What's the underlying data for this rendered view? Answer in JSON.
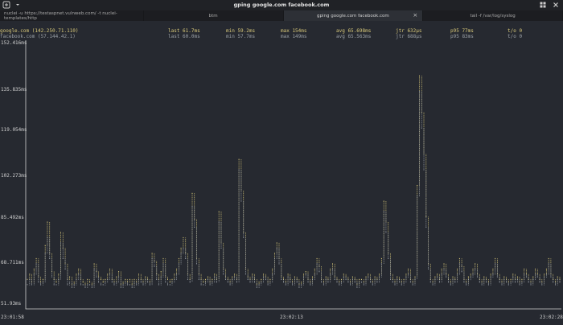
{
  "window": {
    "title": "gping google.com facebook.com",
    "buttons": {
      "new_tab_icon": "plus-icon",
      "menu_icon": "chevron-down-icon",
      "grid_icon": "grid-icon",
      "close_icon": "close-icon"
    }
  },
  "tabs": [
    {
      "label": "nuclei -u https://testaspnet.vulnweb.com/ -t nuclei-templates/http",
      "active": false
    },
    {
      "label": "btm",
      "active": false
    },
    {
      "label": "gping google.com facebook.com",
      "active": true
    },
    {
      "label": "tail -f /var/log/syslog",
      "active": false
    }
  ],
  "hosts": [
    {
      "name": "google.com (142.250.71.110)",
      "last": "last 61.7ms",
      "min": "min 59.2ms",
      "max": "max 154ms",
      "avg": "avg 65.698ms",
      "jtr": "jtr 632µs",
      "p95": "p95 77ms",
      "to": "t/o 0",
      "color": "#d9c97a"
    },
    {
      "name": "facebook.com (57.144.42.1)",
      "last": "last 60.0ms",
      "min": "min 57.7ms",
      "max": "max 149ms",
      "avg": "avg 65.563ms",
      "jtr": "jtr 688µs",
      "p95": "p95 83ms",
      "to": "t/o 0",
      "color": "#9aa0a6"
    }
  ],
  "chart_data": {
    "type": "line",
    "y_ticks": [
      "152.416ms",
      "135.835ms",
      "119.054ms",
      "102.273ms",
      "85.492ms",
      "68.711ms",
      "51.93ms"
    ],
    "x_ticks": [
      "23:01:58",
      "23:02:13",
      "23:02:28"
    ],
    "ylim": [
      51.93,
      152.416
    ],
    "series": [
      {
        "name": "google.com (142.250.71.110)",
        "color": "#d9c97a",
        "values": [
          62,
          64,
          61,
          66,
          70,
          63,
          61,
          62,
          75,
          84,
          72,
          65,
          62,
          61,
          64,
          80,
          74,
          68,
          62,
          63,
          60,
          61,
          64,
          66,
          62,
          61,
          60,
          62,
          61,
          60,
          68,
          65,
          63,
          62,
          61,
          62,
          64,
          66,
          62,
          61,
          63,
          65,
          60,
          61,
          62,
          61,
          62,
          60,
          62,
          61,
          64,
          62,
          61,
          63,
          62,
          61,
          72,
          69,
          64,
          62,
          65,
          70,
          63,
          62,
          61,
          62,
          64,
          66,
          70,
          74,
          78,
          72,
          64,
          62,
          95,
          85,
          70,
          64,
          62,
          61,
          62,
          63,
          61,
          62,
          64,
          62,
          88,
          76,
          66,
          63,
          62,
          61,
          63,
          64,
          62,
          108,
          96,
          80,
          66,
          63,
          62,
          64,
          62,
          60,
          61,
          62,
          64,
          63,
          61,
          62,
          66,
          72,
          76,
          70,
          63,
          62,
          61,
          64,
          62,
          61,
          63,
          62,
          60,
          61,
          64,
          65,
          62,
          61,
          63,
          66,
          70,
          67,
          62,
          61,
          63,
          62,
          66,
          68,
          63,
          62,
          61,
          62,
          64,
          63,
          62,
          61,
          63,
          62,
          60,
          62,
          62,
          61,
          63,
          64,
          62,
          61,
          63,
          62,
          64,
          70,
          92,
          84,
          72,
          64,
          62,
          61,
          63,
          62,
          61,
          62,
          64,
          66,
          62,
          61,
          63,
          98,
          140,
          126,
          110,
          86,
          68,
          62,
          61,
          63,
          64,
          62,
          66,
          68,
          64,
          62,
          61,
          63,
          62,
          66,
          70,
          67,
          62,
          61,
          63,
          64,
          66,
          68,
          64,
          62,
          61,
          63,
          62,
          61,
          64,
          66,
          70,
          64,
          62,
          61,
          63,
          62,
          61,
          62,
          64,
          62,
          63,
          61,
          62,
          66,
          64,
          62,
          61,
          63,
          66,
          64,
          62,
          61,
          64,
          66,
          70,
          64,
          62,
          61,
          63,
          62
        ]
      },
      {
        "name": "facebook.com (57.144.42.1)",
        "color": "#9aa0a6",
        "values": [
          60,
          62,
          60,
          64,
          68,
          61,
          60,
          61,
          72,
          78,
          70,
          63,
          60,
          60,
          62,
          76,
          70,
          66,
          60,
          61,
          59,
          60,
          62,
          64,
          60,
          60,
          59,
          60,
          60,
          59,
          66,
          63,
          61,
          60,
          60,
          61,
          62,
          64,
          61,
          60,
          61,
          63,
          59,
          60,
          61,
          60,
          60,
          59,
          61,
          60,
          62,
          61,
          60,
          62,
          61,
          60,
          70,
          67,
          62,
          60,
          63,
          68,
          61,
          60,
          60,
          61,
          62,
          64,
          68,
          72,
          74,
          70,
          62,
          61,
          90,
          82,
          68,
          62,
          60,
          60,
          61,
          62,
          60,
          61,
          63,
          61,
          84,
          74,
          64,
          62,
          61,
          60,
          62,
          63,
          61,
          104,
          92,
          78,
          64,
          62,
          61,
          63,
          61,
          59,
          60,
          61,
          63,
          62,
          60,
          61,
          64,
          70,
          74,
          68,
          62,
          61,
          60,
          63,
          61,
          60,
          62,
          61,
          59,
          60,
          63,
          64,
          61,
          60,
          62,
          64,
          68,
          65,
          61,
          60,
          62,
          61,
          64,
          66,
          62,
          61,
          60,
          61,
          63,
          62,
          61,
          60,
          62,
          61,
          59,
          61,
          61,
          60,
          62,
          63,
          61,
          60,
          62,
          61,
          63,
          68,
          88,
          80,
          70,
          62,
          61,
          60,
          62,
          61,
          60,
          61,
          63,
          64,
          61,
          60,
          62,
          94,
          134,
          120,
          104,
          82,
          66,
          61,
          60,
          62,
          63,
          61,
          64,
          66,
          63,
          61,
          60,
          62,
          61,
          64,
          68,
          65,
          61,
          60,
          62,
          63,
          64,
          66,
          63,
          61,
          60,
          62,
          61,
          60,
          63,
          64,
          68,
          63,
          61,
          60,
          62,
          61,
          60,
          61,
          63,
          61,
          62,
          60,
          61,
          64,
          63,
          61,
          60,
          62,
          64,
          63,
          61,
          60,
          63,
          64,
          68,
          63,
          61,
          60,
          62,
          61
        ]
      }
    ]
  }
}
